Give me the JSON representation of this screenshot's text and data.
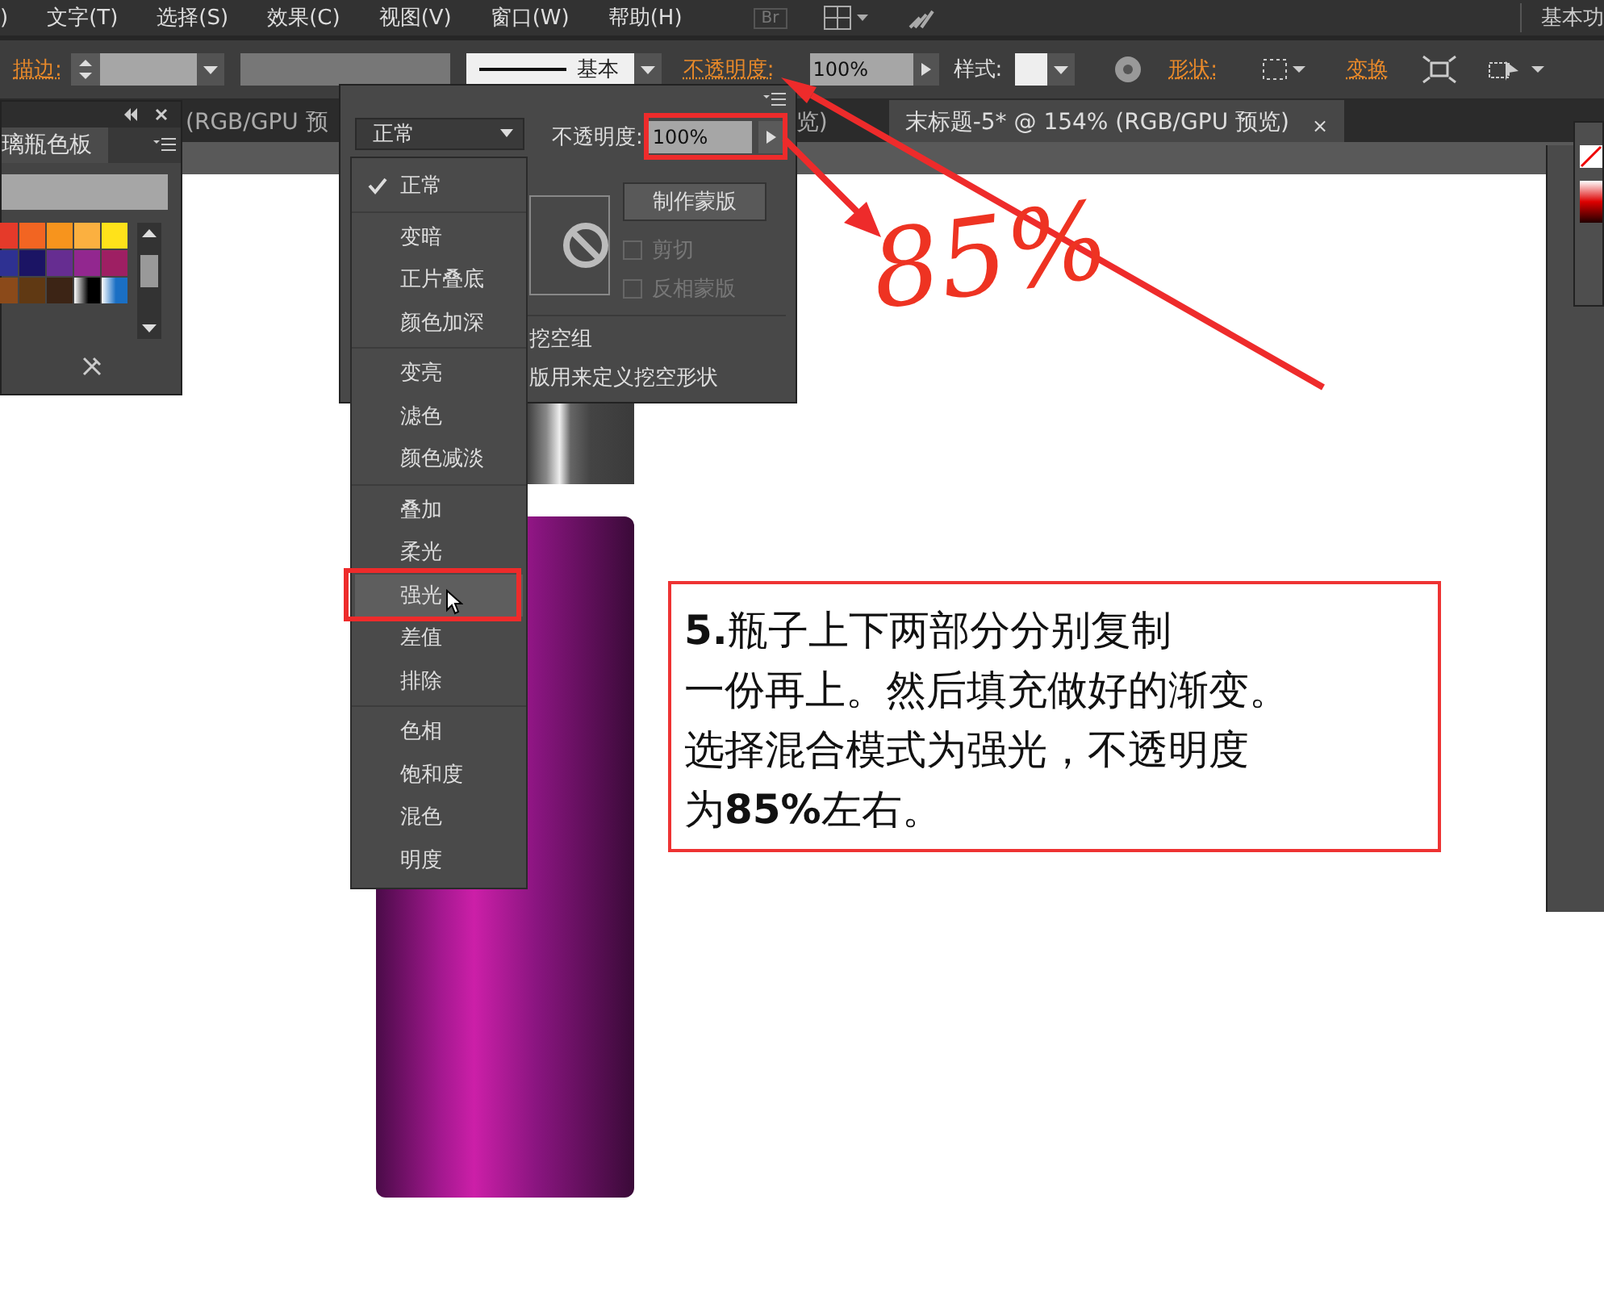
{
  "menu_bar": {
    "items": [
      ")",
      "文字(T)",
      "选择(S)",
      "效果(C)",
      "视图(V)",
      "窗口(W)",
      "帮助(H)"
    ],
    "bridge": "Br",
    "workspace": "基本功"
  },
  "control_bar": {
    "stroke_label": "描边:",
    "stroke_profile": "基本",
    "opacity_label": "不透明度:",
    "opacity_value": "100%",
    "style_label": "样式:",
    "shape_label": "形状:",
    "transform_label": "变换"
  },
  "document_tabs": [
    {
      "title": "(RGB/GPU 预",
      "selected": false
    },
    {
      "title": "览)",
      "selected": false
    },
    {
      "title": "末标题-5* @ 154% (RGB/GPU 预览)",
      "selected": true,
      "close": "×"
    }
  ],
  "swatches_panel": {
    "tab": "璃瓶色板",
    "swatches": [
      {
        "kind": "solid",
        "color": "#e53a2a"
      },
      {
        "kind": "solid",
        "color": "#f26522"
      },
      {
        "kind": "solid",
        "color": "#f7941d"
      },
      {
        "kind": "solid",
        "color": "#fbb040"
      },
      {
        "kind": "solid",
        "color": "#ffe21a"
      },
      {
        "kind": "solid",
        "color": "#2e3192"
      },
      {
        "kind": "solid",
        "color": "#1b1464"
      },
      {
        "kind": "solid",
        "color": "#662d91"
      },
      {
        "kind": "solid",
        "color": "#92278f"
      },
      {
        "kind": "solid",
        "color": "#9e1f63"
      },
      {
        "kind": "solid",
        "color": "#8b4a1a"
      },
      {
        "kind": "solid",
        "color": "#603913"
      },
      {
        "kind": "solid",
        "color": "#3c2415"
      },
      {
        "kind": "gradient",
        "color": "#000000"
      },
      {
        "kind": "gradient",
        "color": "#1a6fc4"
      }
    ]
  },
  "transparency_panel": {
    "blend_mode": "正常",
    "opacity_label": "不透明度:",
    "opacity_value": "100%",
    "mask_button": "制作蒙版",
    "options": [
      {
        "label": "剪切",
        "checked": false,
        "disabled": true
      },
      {
        "label": "反相蒙版",
        "checked": false,
        "disabled": true
      }
    ],
    "knockout_group": "挖空组",
    "knockout_shape": "版用来定义挖空形状"
  },
  "blend_menu": {
    "groups": [
      [
        {
          "label": "正常",
          "checked": true,
          "selected": false
        }
      ],
      [
        {
          "label": "变暗",
          "checked": false,
          "selected": false
        },
        {
          "label": "正片叠底",
          "checked": false,
          "selected": false
        },
        {
          "label": "颜色加深",
          "checked": false,
          "selected": false
        }
      ],
      [
        {
          "label": "变亮",
          "checked": false,
          "selected": false
        },
        {
          "label": "滤色",
          "checked": false,
          "selected": false
        },
        {
          "label": "颜色减淡",
          "checked": false,
          "selected": false
        }
      ],
      [
        {
          "label": "叠加",
          "checked": false,
          "selected": false
        },
        {
          "label": "柔光",
          "checked": false,
          "selected": false
        },
        {
          "label": "强光",
          "checked": false,
          "selected": true
        },
        {
          "label": "差值",
          "checked": false,
          "selected": false
        },
        {
          "label": "排除",
          "checked": false,
          "selected": false
        }
      ],
      [
        {
          "label": "色相",
          "checked": false,
          "selected": false
        },
        {
          "label": "饱和度",
          "checked": false,
          "selected": false
        },
        {
          "label": "混色",
          "checked": false,
          "selected": false
        },
        {
          "label": "明度",
          "checked": false,
          "selected": false
        }
      ]
    ]
  },
  "annotations": {
    "handwritten": "85%",
    "note_lines": [
      "**5.**瓶子上下两部分分别复制",
      "一份再上。然后填充做好的渐变。",
      "选择混合模式为强光，不透明度",
      "为**85%**左右。"
    ]
  }
}
